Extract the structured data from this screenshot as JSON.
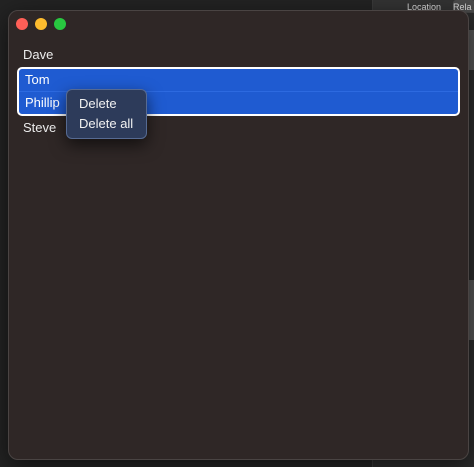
{
  "window": {
    "title_buttons": [
      "close",
      "minimize",
      "zoom"
    ]
  },
  "list": {
    "items": [
      {
        "label": "Dave",
        "selected": false
      },
      {
        "label": "Tom",
        "selected": true
      },
      {
        "label": "Phillip",
        "selected": true
      },
      {
        "label": "Steve",
        "selected": false
      }
    ]
  },
  "context_menu": {
    "items": [
      {
        "label": "Delete"
      },
      {
        "label": "Delete all"
      }
    ]
  },
  "background_app": {
    "tabs": [
      "Location",
      "Rela"
    ]
  },
  "colors": {
    "window_bg": "#2f2726",
    "selection": "#1f5bd1",
    "menu_bg": "#2d3b5a"
  }
}
